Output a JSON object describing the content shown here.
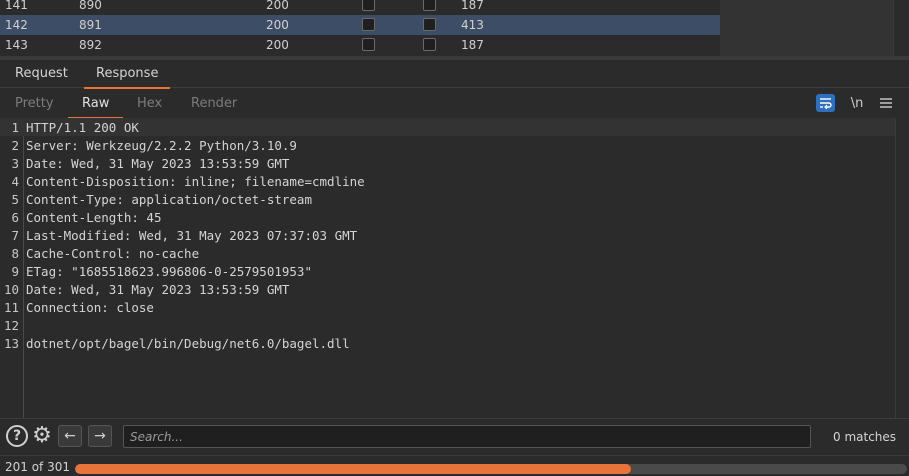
{
  "results": {
    "rows": [
      {
        "num": "141",
        "payload": "890",
        "status": "200",
        "length": "187"
      },
      {
        "num": "142",
        "payload": "891",
        "status": "200",
        "length": "413",
        "selected": true
      },
      {
        "num": "143",
        "payload": "892",
        "status": "200",
        "length": "187"
      }
    ]
  },
  "tabs": {
    "request": "Request",
    "response": "Response"
  },
  "subtabs": {
    "pretty": "Pretty",
    "raw": "Raw",
    "hex": "Hex",
    "render": "Render",
    "newline_toggle": "\\n"
  },
  "editor": {
    "lines": [
      {
        "n": "1",
        "key": "",
        "value": "HTTP/1.1 200 OK"
      },
      {
        "n": "2",
        "key": "Server",
        "value": " Werkzeug/2.2.2 Python/3.10.9"
      },
      {
        "n": "3",
        "key": "Date",
        "value": " Wed, 31 May 2023 13:53:59 GMT"
      },
      {
        "n": "4",
        "key": "Content-Disposition",
        "value": " inline; filename=cmdline"
      },
      {
        "n": "5",
        "key": "Content-Type",
        "value": " application/octet-stream"
      },
      {
        "n": "6",
        "key": "Content-Length",
        "value": " 45"
      },
      {
        "n": "7",
        "key": "Last-Modified",
        "value": " Wed, 31 May 2023 07:37:03 GMT"
      },
      {
        "n": "8",
        "key": "Cache-Control",
        "value": " no-cache"
      },
      {
        "n": "9",
        "key": "ETag",
        "value": " \"1685518623.996806-0-2579501953\""
      },
      {
        "n": "10",
        "key": "Date",
        "value": " Wed, 31 May 2023 13:53:59 GMT"
      },
      {
        "n": "11",
        "key": "Connection",
        "value": " close"
      },
      {
        "n": "12",
        "key": "",
        "value": ""
      },
      {
        "n": "13",
        "key": "",
        "value": "dotnet/opt/bagel/bin/Debug/net6.0/bagel.dll"
      }
    ]
  },
  "search": {
    "placeholder": "Search...",
    "value": "",
    "matches": "0 matches"
  },
  "progress": {
    "text": "201 of 301",
    "fraction": 0.6678
  },
  "colors": {
    "accent": "#e8743b",
    "selection": "#3d4d66",
    "wrap_toggle": "#2f6fbf"
  }
}
